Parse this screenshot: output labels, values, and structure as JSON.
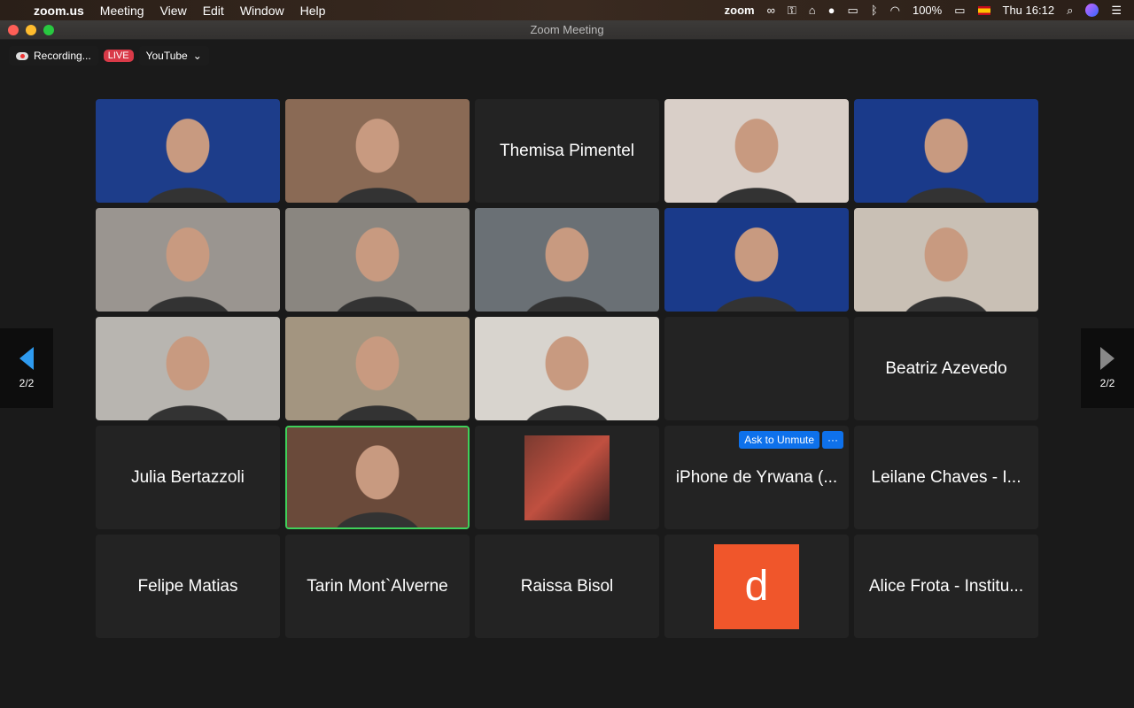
{
  "menubar": {
    "app": "zoom.us",
    "items": [
      "Meeting",
      "View",
      "Edit",
      "Window",
      "Help"
    ],
    "status": {
      "zoom": "zoom",
      "battery": "100%",
      "clock": "Thu 16:12"
    }
  },
  "window": {
    "title": "Zoom Meeting"
  },
  "toolbar": {
    "recording": "Recording...",
    "live": "LIVE",
    "stream": "YouTube"
  },
  "pager": {
    "prev": "2/2",
    "next": "2/2"
  },
  "accent": "#0e71eb",
  "speaker_color": "#3fd05a",
  "tiles": [
    {
      "type": "video",
      "bg": "#1d3d8a"
    },
    {
      "type": "video",
      "bg": "#8a6a55"
    },
    {
      "type": "name",
      "name": "Themisa Pimentel"
    },
    {
      "type": "video",
      "bg": "#d9cfc8"
    },
    {
      "type": "video",
      "bg": "#1a3a8a"
    },
    {
      "type": "video",
      "bg": "#9a9590"
    },
    {
      "type": "video",
      "bg": "#8a8680"
    },
    {
      "type": "video",
      "bg": "#6a7075"
    },
    {
      "type": "video",
      "bg": "#1a3a8a"
    },
    {
      "type": "video",
      "bg": "#c9c0b5"
    },
    {
      "type": "video",
      "bg": "#b8b5b0"
    },
    {
      "type": "video",
      "bg": "#a39580"
    },
    {
      "type": "video",
      "bg": "#d8d4ce"
    },
    {
      "type": "empty"
    },
    {
      "type": "name",
      "name": "Beatriz Azevedo"
    },
    {
      "type": "name",
      "name": "Julia Bertazzoli"
    },
    {
      "type": "video",
      "bg": "#6a4a3a",
      "speaking": true
    },
    {
      "type": "photo",
      "bg": "#7a3a30"
    },
    {
      "type": "name",
      "name": "iPhone de Yrwana (...",
      "ask": "Ask to Unmute",
      "more": "···"
    },
    {
      "type": "name",
      "name": "Leilane Chaves - I..."
    },
    {
      "type": "name",
      "name": "Felipe Matias"
    },
    {
      "type": "name",
      "name": "Tarin Mont`Alverne"
    },
    {
      "type": "name",
      "name": "Raissa Bisol"
    },
    {
      "type": "avatar",
      "letter": "d"
    },
    {
      "type": "name",
      "name": "Alice Frota - Institu..."
    }
  ]
}
